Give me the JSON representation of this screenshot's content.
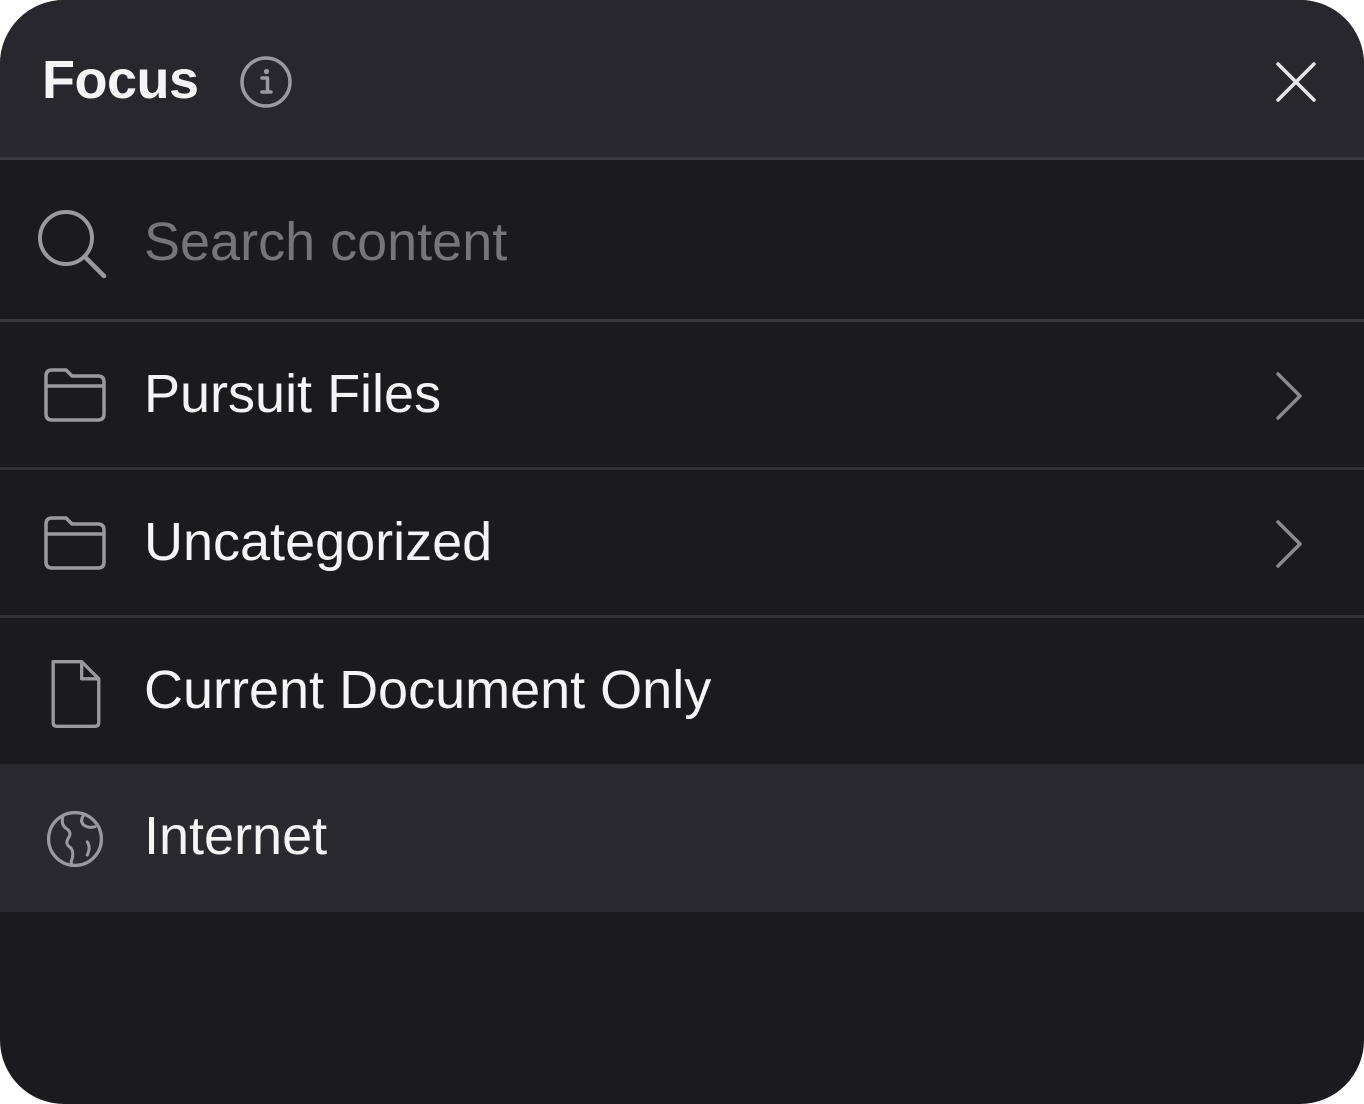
{
  "header": {
    "title": "Focus"
  },
  "icons": {
    "info": "info-icon",
    "close": "close-icon",
    "search": "search-icon",
    "folder": "folder-icon",
    "document": "document-icon",
    "globe": "globe-icon",
    "chevron": "chevron-right-icon"
  },
  "search": {
    "placeholder": "Search content",
    "value": ""
  },
  "items": [
    {
      "label": "Pursuit Files",
      "icon": "folder-icon",
      "has_submenu": true
    },
    {
      "label": "Uncategorized",
      "icon": "folder-icon",
      "has_submenu": true
    },
    {
      "label": "Current Document Only",
      "icon": "document-icon",
      "has_submenu": false
    },
    {
      "label": "Internet",
      "icon": "globe-icon",
      "has_submenu": false,
      "highlighted": true
    }
  ],
  "colors": {
    "panel_bg": "#1b1a1f",
    "header_bg": "#28272d",
    "highlight_bg": "#2a292f",
    "text": "#f5f5f7",
    "placeholder": "#76757c",
    "icon": "#9a999f"
  }
}
